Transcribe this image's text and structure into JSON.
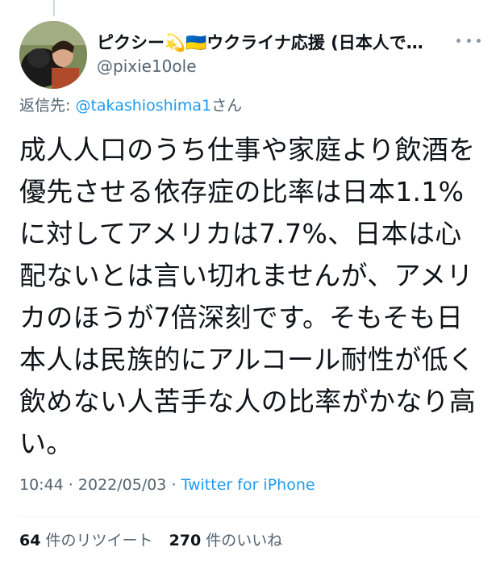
{
  "user": {
    "display_name": "ピクシー💫🇺🇦ウクライナ応援 (日本人で…",
    "handle": "@pixie10ole"
  },
  "reply": {
    "prefix": "返信先:",
    "mention": "@takashioshima1",
    "suffix": "さん"
  },
  "tweet": {
    "text": "成人人口のうち仕事や家庭より飲酒を優先させる依存症の比率は日本1.1%に対してアメリカは7.7%、日本は心配ないとは言い切れませんが、アメリカのほうが7倍深刻です。そもそも日本人は民族的にアルコール耐性が低く飲めない人苦手な人の比率がかなり高い。",
    "time": "10:44",
    "separator1": " · ",
    "date": "2022/05/03",
    "separator2": " · ",
    "source": "Twitter for iPhone"
  },
  "stats": {
    "retweet_count": "64",
    "retweet_label": "件のリツイート",
    "like_count": "270",
    "like_label": "件のいいね"
  },
  "icons": {
    "more": "more-horizontal-icon"
  },
  "colors": {
    "link": "#1d9bf0",
    "secondary_text": "#536471",
    "primary_text": "#0f1419"
  }
}
